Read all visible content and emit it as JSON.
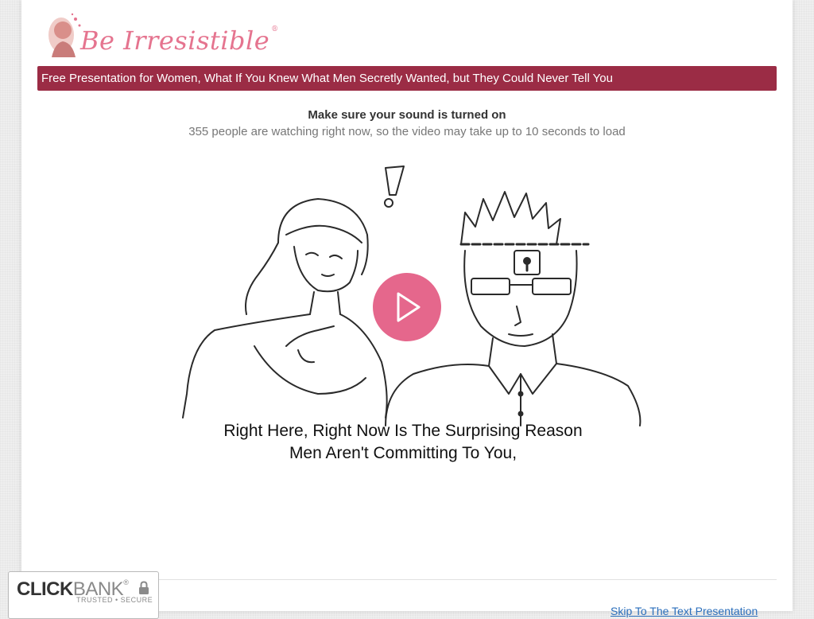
{
  "logo": {
    "text": "Be Irresistible",
    "registered": "®"
  },
  "banner": {
    "text": "Free Presentation for Women, What If You Knew What Men Secretly Wanted, but They Could Never Tell You"
  },
  "notice": {
    "sound": "Make sure your sound is turned on",
    "watching": "355 people are watching right now, so the video may take up to 10 seconds to load"
  },
  "video": {
    "caption_line1": "Right Here, Right Now Is The Surprising Reason",
    "caption_line2": "Men Aren't Committing To You,",
    "play_icon": "play-icon",
    "exclamation": "!"
  },
  "footer": {
    "skip_link": "Skip To The Text Presentation"
  },
  "clickbank": {
    "click": "CLICK",
    "bank": "BANK",
    "reg": "®",
    "tagline": "TRUSTED • SECURE",
    "lock_icon": "lock-icon"
  },
  "colors": {
    "banner": "#9b2c45",
    "play": "#e5678c",
    "logo": "#e5748f",
    "link": "#2a6ebb"
  }
}
